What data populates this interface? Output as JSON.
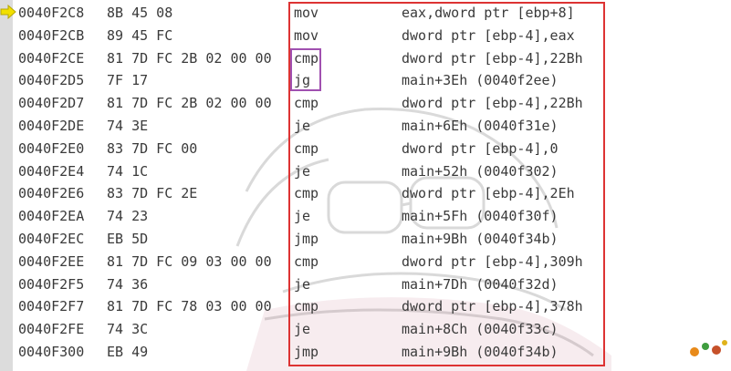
{
  "instruction_pointer_icon": "arrow-right-icon",
  "colors": {
    "highlight_box": "#dd3333",
    "selection_box": "#a050b0",
    "arrow": "#f2e000",
    "gutter": "#dcdcdc"
  },
  "lines": [
    {
      "addr": "0040F2C8",
      "bytes": "8B 45 08",
      "mnemonic": "mov",
      "operands": "eax,dword ptr [ebp+8]"
    },
    {
      "addr": "0040F2CB",
      "bytes": "89 45 FC",
      "mnemonic": "mov",
      "operands": "dword ptr [ebp-4],eax"
    },
    {
      "addr": "0040F2CE",
      "bytes": "81 7D FC 2B 02 00 00",
      "mnemonic": "cmp",
      "operands": "dword ptr [ebp-4],22Bh"
    },
    {
      "addr": "0040F2D5",
      "bytes": "7F 17",
      "mnemonic": "jg",
      "operands": "main+3Eh (0040f2ee)"
    },
    {
      "addr": "0040F2D7",
      "bytes": "81 7D FC 2B 02 00 00",
      "mnemonic": "cmp",
      "operands": "dword ptr [ebp-4],22Bh"
    },
    {
      "addr": "0040F2DE",
      "bytes": "74 3E",
      "mnemonic": "je",
      "operands": "main+6Eh (0040f31e)"
    },
    {
      "addr": "0040F2E0",
      "bytes": "83 7D FC 00",
      "mnemonic": "cmp",
      "operands": "dword ptr [ebp-4],0"
    },
    {
      "addr": "0040F2E4",
      "bytes": "74 1C",
      "mnemonic": "je",
      "operands": "main+52h (0040f302)"
    },
    {
      "addr": "0040F2E6",
      "bytes": "83 7D FC 2E",
      "mnemonic": "cmp",
      "operands": "dword ptr [ebp-4],2Eh"
    },
    {
      "addr": "0040F2EA",
      "bytes": "74 23",
      "mnemonic": "je",
      "operands": "main+5Fh (0040f30f)"
    },
    {
      "addr": "0040F2EC",
      "bytes": "EB 5D",
      "mnemonic": "jmp",
      "operands": "main+9Bh (0040f34b)"
    },
    {
      "addr": "0040F2EE",
      "bytes": "81 7D FC 09 03 00 00",
      "mnemonic": "cmp",
      "operands": "dword ptr [ebp-4],309h"
    },
    {
      "addr": "0040F2F5",
      "bytes": "74 36",
      "mnemonic": "je",
      "operands": "main+7Dh (0040f32d)"
    },
    {
      "addr": "0040F2F7",
      "bytes": "81 7D FC 78 03 00 00",
      "mnemonic": "cmp",
      "operands": "dword ptr [ebp-4],378h"
    },
    {
      "addr": "0040F2FE",
      "bytes": "74 3C",
      "mnemonic": "je",
      "operands": "main+8Ch (0040f33c)"
    },
    {
      "addr": "0040F300",
      "bytes": "EB 49",
      "mnemonic": "jmp",
      "operands": "main+9Bh (0040f34b)"
    }
  ]
}
